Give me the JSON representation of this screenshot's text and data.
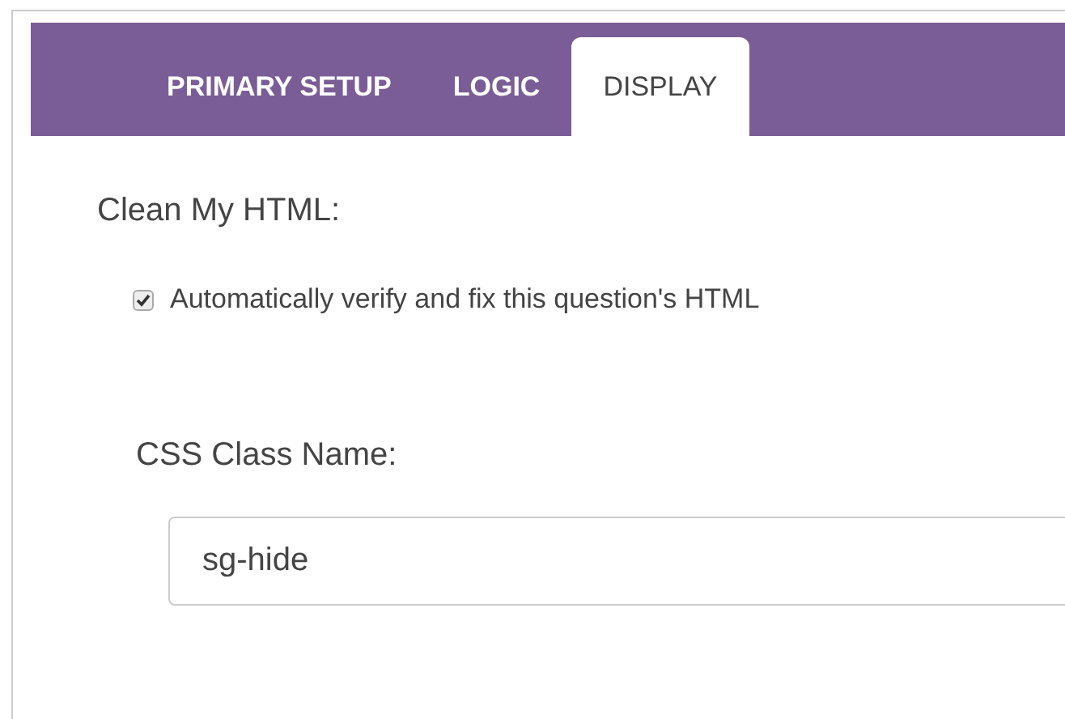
{
  "tabs": [
    {
      "label": "PRIMARY SETUP",
      "selected": false
    },
    {
      "label": "LOGIC",
      "selected": false
    },
    {
      "label": "DISPLAY",
      "selected": true
    }
  ],
  "clean_html": {
    "label": "Clean My HTML:",
    "option": {
      "label": "Automatically verify and fix this question's HTML",
      "checked": true
    }
  },
  "css_class": {
    "label": "CSS Class Name:",
    "value": "sg-hide"
  }
}
